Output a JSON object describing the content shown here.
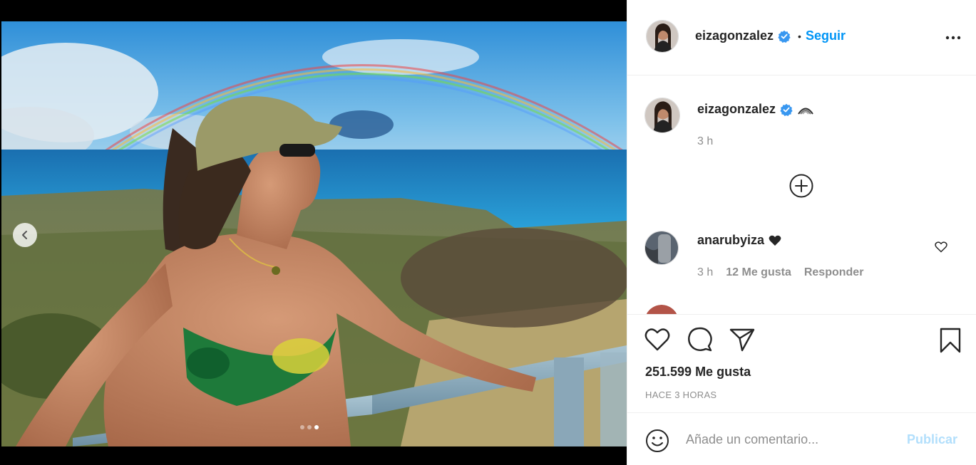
{
  "post": {
    "username": "eizagonzalez",
    "follow_separator": "•",
    "follow_label": "Seguir"
  },
  "caption": {
    "username": "eizagonzalez",
    "time": "3 h"
  },
  "comments": [
    {
      "username": "anarubyiza",
      "time": "3 h",
      "likes": "12 Me gusta",
      "reply_label": "Responder"
    }
  ],
  "stats": {
    "likes": "251.599 Me gusta",
    "posted": "HACE 3 HORAS"
  },
  "composer": {
    "placeholder": "Añade un comentario...",
    "publish_label": "Publicar"
  },
  "carousel": {
    "total": 3,
    "active": 3
  },
  "colors": {
    "accent": "#0095f6",
    "publish_disabled": "#b2dffc",
    "muted": "#8e8e8e"
  }
}
